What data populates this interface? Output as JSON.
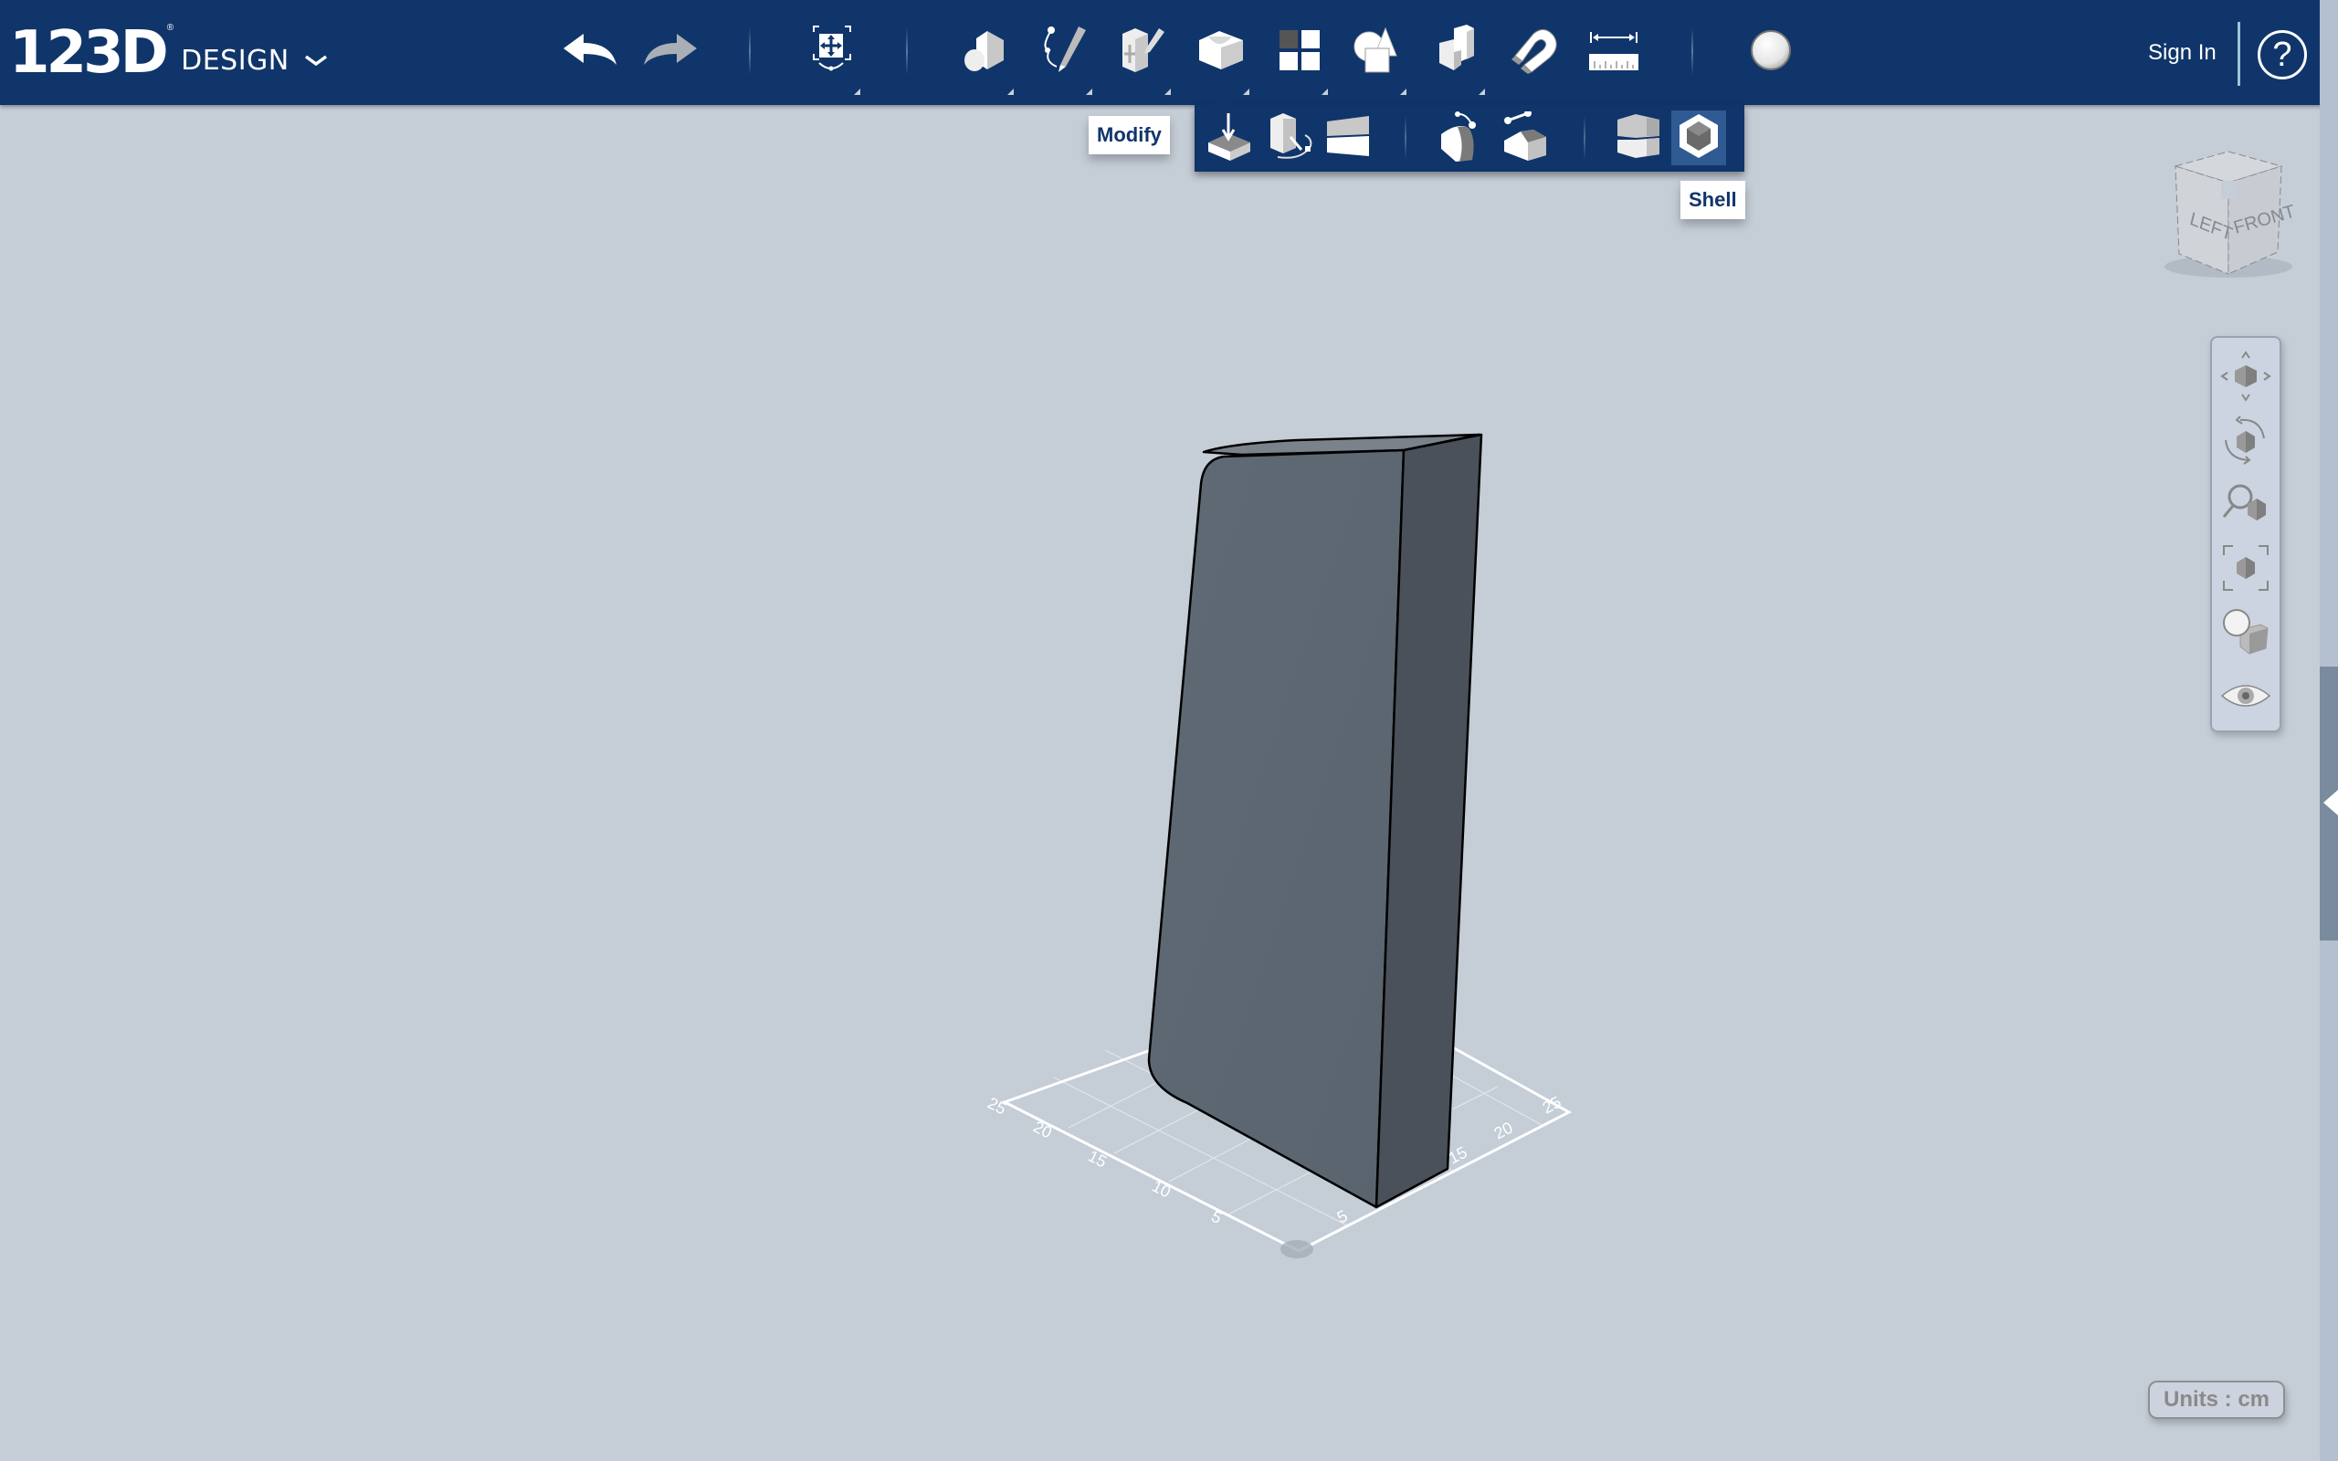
{
  "app": {
    "logo_number": "123D",
    "logo_reg": "®",
    "logo_word": "DESIGN",
    "menu_icon": "chevron-down-icon"
  },
  "toolbar": {
    "items": [
      {
        "id": "undo",
        "icon": "undo-arrow-icon"
      },
      {
        "id": "redo",
        "icon": "redo-arrow-icon"
      },
      {
        "id": "transform",
        "icon": "transform-move-icon",
        "has_submenu": true
      },
      {
        "id": "primitives",
        "icon": "primitives-icon",
        "has_submenu": true
      },
      {
        "id": "sketch",
        "icon": "sketch-icon",
        "has_submenu": true
      },
      {
        "id": "construct",
        "icon": "construct-icon",
        "has_submenu": true
      },
      {
        "id": "modify",
        "icon": "modify-icon",
        "has_submenu": true,
        "active": true
      },
      {
        "id": "pattern",
        "icon": "pattern-icon",
        "has_submenu": true
      },
      {
        "id": "grouping",
        "icon": "grouping-icon",
        "has_submenu": true
      },
      {
        "id": "combine",
        "icon": "combine-icon",
        "has_submenu": true
      },
      {
        "id": "snap",
        "icon": "snap-magnet-icon"
      },
      {
        "id": "measure",
        "icon": "measure-ruler-icon"
      },
      {
        "id": "material",
        "icon": "material-sphere-icon"
      }
    ],
    "sign_in": "Sign In",
    "help": "?"
  },
  "modify_menu": {
    "tooltip": "Modify",
    "items": [
      {
        "id": "press-pull",
        "icon": "press-pull-icon"
      },
      {
        "id": "tweak",
        "icon": "tweak-icon"
      },
      {
        "id": "split-face",
        "icon": "split-face-icon"
      },
      {
        "id": "fillet",
        "icon": "fillet-icon"
      },
      {
        "id": "chamfer",
        "icon": "chamfer-icon"
      },
      {
        "id": "split-solid",
        "icon": "split-solid-icon"
      },
      {
        "id": "shell",
        "icon": "shell-icon",
        "active": true
      }
    ],
    "hover_tooltip": "Shell"
  },
  "viewcube": {
    "faces": {
      "left": "LEFT",
      "front": "FRONT"
    }
  },
  "nav_bar": {
    "items": [
      {
        "id": "pan",
        "icon": "pan-icon"
      },
      {
        "id": "orbit",
        "icon": "orbit-icon"
      },
      {
        "id": "zoom",
        "icon": "zoom-icon"
      },
      {
        "id": "fit",
        "icon": "fit-to-view-icon"
      },
      {
        "id": "view-mode",
        "icon": "material-view-icon"
      },
      {
        "id": "visibility",
        "icon": "eye-icon"
      }
    ]
  },
  "grid": {
    "left_axis_labels": [
      "5",
      "10",
      "15",
      "20",
      "25"
    ],
    "right_axis_labels": [
      "5",
      "15",
      "20",
      "25"
    ]
  },
  "status": {
    "units": "Units : cm"
  },
  "colors": {
    "toolbar_bg": "#10356a",
    "viewport_bg": "#c5cdd7",
    "model_front": "#5c6670",
    "model_side": "#4a515b",
    "active_item": "#2f5a92"
  }
}
